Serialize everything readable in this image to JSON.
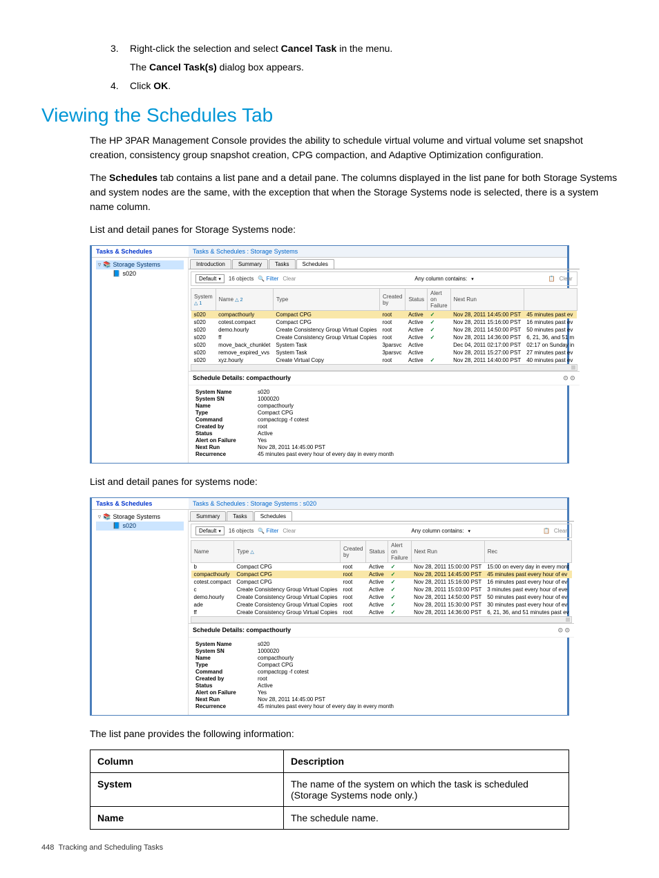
{
  "steps": [
    {
      "num": "3.",
      "text_before": "Right-click the selection and select ",
      "bold": "Cancel Task",
      "text_after": " in the menu.",
      "sub_before": "The ",
      "sub_bold": "Cancel Task(s)",
      "sub_after": " dialog box appears."
    },
    {
      "num": "4.",
      "text_before": "Click ",
      "bold": "OK",
      "text_after": "."
    }
  ],
  "heading": "Viewing the Schedules Tab",
  "para1": "The HP 3PAR Management Console provides the ability to schedule virtual volume and virtual volume set snapshot creation, consistency group snapshot creation, CPG compaction, and Adaptive Optimization configuration.",
  "para2_before": "The ",
  "para2_bold": "Schedules",
  "para2_after": " tab contains a list pane and a detail pane. The columns displayed in the list pane for both Storage Systems and system nodes are the same, with the exception that when the Storage Systems node is selected, there is a system name column.",
  "para3": "List and detail panes for Storage Systems node:",
  "para4": "List and detail panes for systems node:",
  "para5": "The list pane provides the following information:",
  "ss1": {
    "nav_title": "Tasks & Schedules",
    "breadcrumb": "Tasks & Schedules : Storage Systems",
    "nav_items": [
      {
        "icon": "▿",
        "node": "📚",
        "label": "Storage Systems",
        "selected": true,
        "indent": 0
      },
      {
        "icon": "",
        "node": "📘",
        "label": "s020",
        "selected": false,
        "indent": 1
      }
    ],
    "tabs": [
      "Introduction",
      "Summary",
      "Tasks",
      "Schedules"
    ],
    "active_tab": 3,
    "toolbar": {
      "dropdown": "Default",
      "count": "16 objects",
      "filter": "Filter",
      "clear1": "Clear",
      "any_col": "Any column contains:",
      "clear2": "Clear"
    },
    "columns": [
      "System",
      "Name",
      "Type",
      "Created by",
      "Status",
      "Alert on Failure",
      "Next Run",
      ""
    ],
    "col_sort": {
      "0": "△ 1",
      "1": "△ 2"
    },
    "rows": [
      {
        "sel": true,
        "c": [
          "s020",
          "compacthourly",
          "Compact CPG",
          "root",
          "Active",
          "✓",
          "Nov 28, 2011 14:45:00 PST",
          "45 minutes past ev"
        ]
      },
      {
        "c": [
          "s020",
          "cotest.compact",
          "Compact CPG",
          "root",
          "Active",
          "✓",
          "Nov 28, 2011 15:16:00 PST",
          "16 minutes past ev"
        ]
      },
      {
        "c": [
          "s020",
          "demo.hourly",
          "Create Consistency Group Virtual Copies",
          "root",
          "Active",
          "✓",
          "Nov 28, 2011 14:50:00 PST",
          "50 minutes past ev"
        ]
      },
      {
        "c": [
          "s020",
          "ff",
          "Create Consistency Group Virtual Copies",
          "root",
          "Active",
          "✓",
          "Nov 28, 2011 14:36:00 PST",
          "6, 21, 36, and 51 m"
        ]
      },
      {
        "c": [
          "s020",
          "move_back_chunklet",
          "System Task",
          "3parsvc",
          "Active",
          "",
          "Dec 04, 2011 02:17:00 PST",
          "02:17 on Sunday in"
        ]
      },
      {
        "c": [
          "s020",
          "remove_expired_vvs",
          "System Task",
          "3parsvc",
          "Active",
          "",
          "Nov 28, 2011 15:27:00 PST",
          "27 minutes past ev"
        ]
      },
      {
        "c": [
          "s020",
          "xyz.hourly",
          "Create Virtual Copy",
          "root",
          "Active",
          "✓",
          "Nov 28, 2011 14:40:00 PST",
          "40 minutes past ev"
        ]
      }
    ],
    "detail_title": "Schedule Details: compacthourly",
    "details": [
      {
        "l": "System Name",
        "v": "s020"
      },
      {
        "l": "System SN",
        "v": "1000020"
      },
      {
        "l": "Name",
        "v": "compacthourly"
      },
      {
        "l": "Type",
        "v": "Compact CPG"
      },
      {
        "l": "Command",
        "v": "compactcpg -f cotest"
      },
      {
        "l": "Created by",
        "v": "root"
      },
      {
        "l": "Status",
        "v": "Active"
      },
      {
        "l": "Alert on Failure",
        "v": "Yes"
      },
      {
        "l": "Next Run",
        "v": "Nov 28, 2011 14:45:00 PST"
      },
      {
        "l": "Recurrence",
        "v": "45 minutes past every hour of every day in every month"
      }
    ]
  },
  "ss2": {
    "nav_title": "Tasks & Schedules",
    "breadcrumb": "Tasks & Schedules : Storage Systems : s020",
    "nav_items": [
      {
        "icon": "▿",
        "node": "📚",
        "label": "Storage Systems",
        "selected": false,
        "indent": 0
      },
      {
        "icon": "",
        "node": "📘",
        "label": "s020",
        "selected": true,
        "indent": 1
      }
    ],
    "tabs": [
      "Summary",
      "Tasks",
      "Schedules"
    ],
    "active_tab": 2,
    "toolbar": {
      "dropdown": "Default",
      "count": "16 objects",
      "filter": "Filter",
      "clear1": "Clear",
      "any_col": "Any column contains:",
      "clear2": "Clear"
    },
    "columns": [
      "Name",
      "Type",
      "Created by",
      "Status",
      "Alert on Failure",
      "Next Run",
      "Rec"
    ],
    "col_sort": {
      "1": "△"
    },
    "rows": [
      {
        "c": [
          "b",
          "Compact CPG",
          "root",
          "Active",
          "✓",
          "Nov 28, 2011 15:00:00 PST",
          "15:00 on every day in every mont"
        ]
      },
      {
        "sel": true,
        "c": [
          "compacthourly",
          "Compact CPG",
          "root",
          "Active",
          "✓",
          "Nov 28, 2011 14:45:00 PST",
          "45 minutes past every hour of ev"
        ]
      },
      {
        "c": [
          "cotest.compact",
          "Compact CPG",
          "root",
          "Active",
          "✓",
          "Nov 28, 2011 15:16:00 PST",
          "16 minutes past every hour of ev"
        ]
      },
      {
        "c": [
          "c",
          "Create Consistency Group Virtual Copies",
          "root",
          "Active",
          "✓",
          "Nov 28, 2011 15:03:00 PST",
          "3 minutes past every hour of eve"
        ]
      },
      {
        "c": [
          "demo.hourly",
          "Create Consistency Group Virtual Copies",
          "root",
          "Active",
          "✓",
          "Nov 28, 2011 14:50:00 PST",
          "50 minutes past every hour of ev"
        ]
      },
      {
        "c": [
          "ade",
          "Create Consistency Group Virtual Copies",
          "root",
          "Active",
          "✓",
          "Nov 28, 2011 15:30:00 PST",
          "30 minutes past every hour of ev"
        ]
      },
      {
        "c": [
          "ff",
          "Create Consistency Group Virtual Copies",
          "root",
          "Active",
          "✓",
          "Nov 28, 2011 14:36:00 PST",
          "6, 21, 36, and 51 minutes past ev"
        ]
      }
    ],
    "detail_title": "Schedule Details: compacthourly",
    "details": [
      {
        "l": "System Name",
        "v": "s020"
      },
      {
        "l": "System SN",
        "v": "1000020"
      },
      {
        "l": "Name",
        "v": "compacthourly"
      },
      {
        "l": "Type",
        "v": "Compact CPG"
      },
      {
        "l": "Command",
        "v": "compactcpg -f cotest"
      },
      {
        "l": "Created by",
        "v": "root"
      },
      {
        "l": "Status",
        "v": "Active"
      },
      {
        "l": "Alert on Failure",
        "v": "Yes"
      },
      {
        "l": "Next Run",
        "v": "Nov 28, 2011 14:45:00 PST"
      },
      {
        "l": "Recurrence",
        "v": "45 minutes past every hour of every day in every month"
      }
    ]
  },
  "desc_table": {
    "headers": [
      "Column",
      "Description"
    ],
    "rows": [
      {
        "c1": "System",
        "c2": "The name of the system on which the task is scheduled (Storage Systems node only.)"
      },
      {
        "c1": "Name",
        "c2": "The schedule name."
      }
    ]
  },
  "footer": {
    "page": "448",
    "title": "Tracking and Scheduling Tasks"
  }
}
